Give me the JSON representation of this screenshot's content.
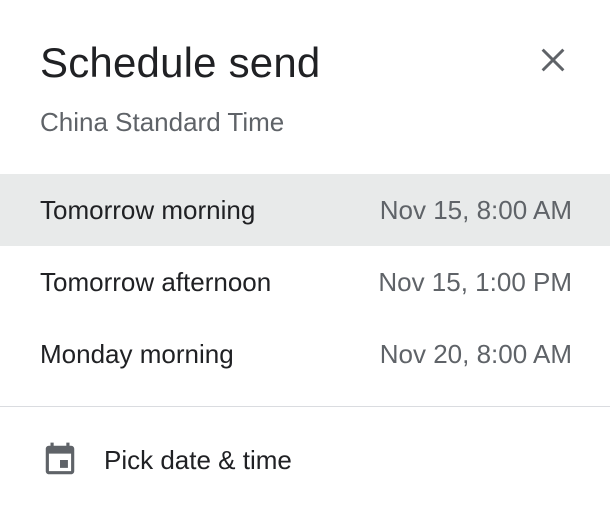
{
  "dialog": {
    "title": "Schedule send",
    "subtitle": "China Standard Time",
    "close_icon": "close-icon"
  },
  "options": [
    {
      "label": "Tomorrow morning",
      "time": "Nov 15, 8:00 AM",
      "selected": true
    },
    {
      "label": "Tomorrow afternoon",
      "time": "Nov 15, 1:00 PM",
      "selected": false
    },
    {
      "label": "Monday morning",
      "time": "Nov 20, 8:00 AM",
      "selected": false
    }
  ],
  "pick": {
    "label": "Pick date & time",
    "icon": "calendar-icon"
  },
  "colors": {
    "selected_background": "#e8eaea",
    "primary_text": "#202124",
    "secondary_text": "#5f6368",
    "icon": "#5f6368",
    "divider": "#dadce0"
  }
}
